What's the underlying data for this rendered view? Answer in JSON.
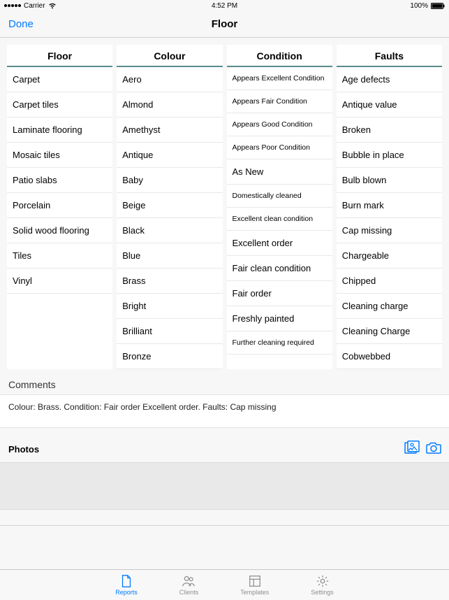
{
  "status": {
    "carrier": "Carrier",
    "time": "4:52 PM",
    "battery": "100%"
  },
  "nav": {
    "done": "Done",
    "title": "Floor"
  },
  "columns": [
    {
      "header": "Floor",
      "items": [
        {
          "t": "Carpet"
        },
        {
          "t": "Carpet tiles"
        },
        {
          "t": "Laminate flooring"
        },
        {
          "t": "Mosaic tiles"
        },
        {
          "t": "Patio slabs"
        },
        {
          "t": "Porcelain"
        },
        {
          "t": "Solid wood flooring"
        },
        {
          "t": "Tiles"
        },
        {
          "t": "Vinyl"
        }
      ]
    },
    {
      "header": "Colour",
      "items": [
        {
          "t": "Aero"
        },
        {
          "t": "Almond"
        },
        {
          "t": "Amethyst"
        },
        {
          "t": "Antique"
        },
        {
          "t": "Baby"
        },
        {
          "t": "Beige"
        },
        {
          "t": "Black"
        },
        {
          "t": "Blue"
        },
        {
          "t": "Brass"
        },
        {
          "t": "Bright"
        },
        {
          "t": "Brilliant"
        },
        {
          "t": "Bronze"
        }
      ]
    },
    {
      "header": "Condition",
      "items": [
        {
          "t": "Appears Excellent Condition",
          "sm": true
        },
        {
          "t": "Appears Fair Condition",
          "sm": true
        },
        {
          "t": "Appears Good Condition",
          "sm": true
        },
        {
          "t": "Appears Poor Condition",
          "sm": true
        },
        {
          "t": "As New"
        },
        {
          "t": "Domestically cleaned",
          "sm": true
        },
        {
          "t": "Excellent clean condition",
          "sm": true
        },
        {
          "t": "Excellent order"
        },
        {
          "t": "Fair clean condition"
        },
        {
          "t": "Fair order"
        },
        {
          "t": "Freshly painted"
        },
        {
          "t": "Further cleaning required",
          "sm": true
        }
      ]
    },
    {
      "header": "Faults",
      "items": [
        {
          "t": "Age defects"
        },
        {
          "t": "Antique value"
        },
        {
          "t": "Broken"
        },
        {
          "t": "Bubble in place"
        },
        {
          "t": "Bulb blown"
        },
        {
          "t": "Burn mark"
        },
        {
          "t": "Cap missing"
        },
        {
          "t": "Chargeable"
        },
        {
          "t": "Chipped"
        },
        {
          "t": "Cleaning charge"
        },
        {
          "t": "Cleaning Charge"
        },
        {
          "t": "Cobwebbed"
        }
      ]
    }
  ],
  "comments": {
    "label": "Comments",
    "text": "Colour: Brass. Condition: Fair order Excellent order. Faults: Cap missing"
  },
  "photos": {
    "label": "Photos"
  },
  "tabs": {
    "reports": "Reports",
    "clients": "Clients",
    "templates": "Templates",
    "settings": "Settings"
  }
}
